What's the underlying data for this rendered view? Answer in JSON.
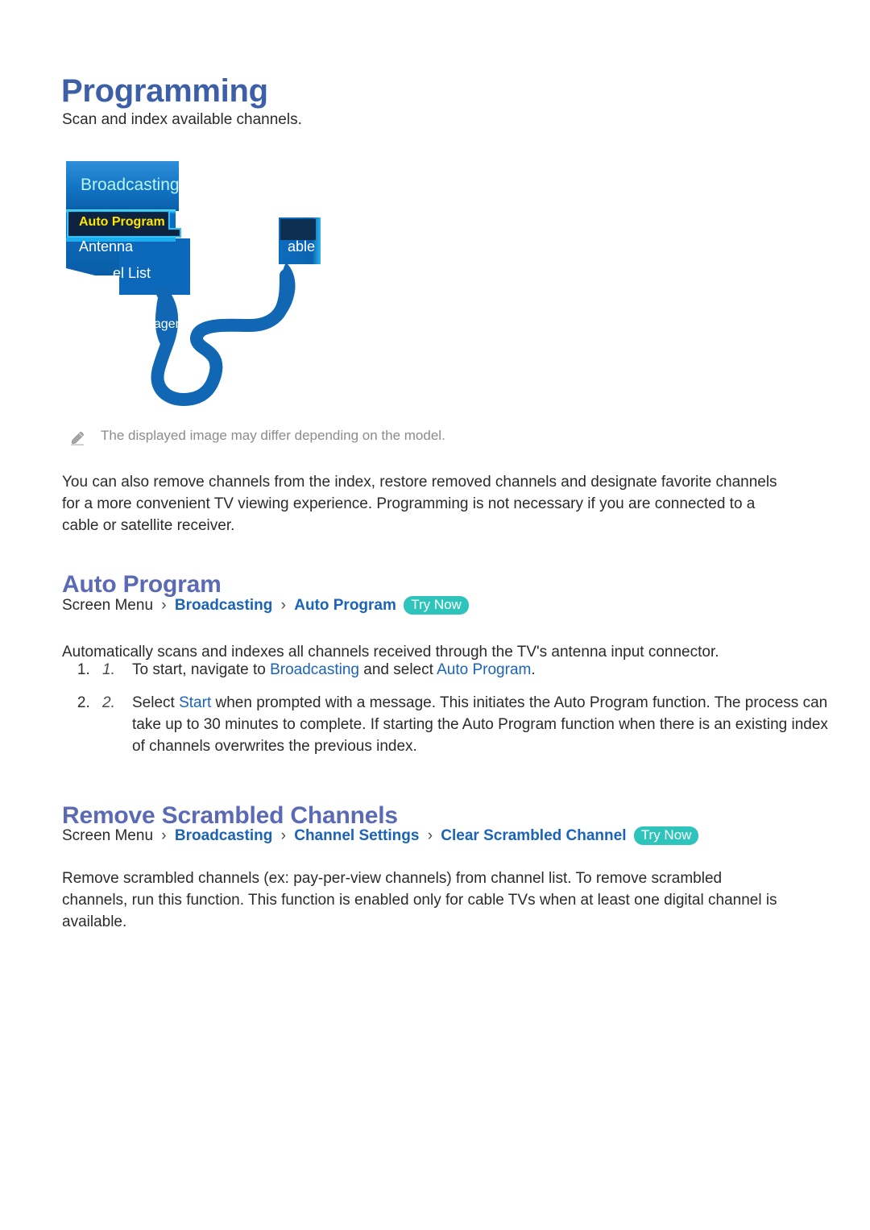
{
  "document": {
    "title": "Programming",
    "intro": "Scan and index available channels."
  },
  "illustration": {
    "menu_title": "Broadcasting",
    "items": [
      {
        "label": "Auto Program",
        "state": "highlighted"
      },
      {
        "label": "Antenna",
        "state": "normal"
      },
      {
        "label": "el List",
        "state": "clipped"
      },
      {
        "label": "nager",
        "state": "clipped"
      },
      {
        "label": "able",
        "state": "clipped"
      }
    ],
    "colors": {
      "panel_blue": "#0b6cc0",
      "panel_blue_dark": "#0a5fa8",
      "header_gradient_top": "#2f8fd8",
      "header_gradient_bottom": "#0a63b4",
      "highlight_fill": "#0d2340",
      "highlight_glow": "#27c6ff",
      "highlight_text": "#ffe500",
      "title_text": "#b8f5ef",
      "cable_blue": "#1167b4"
    }
  },
  "note": {
    "icon": "pencil-icon",
    "text": "The displayed image may differ depending on the model."
  },
  "paragraphs": {
    "remove_channels": "You can also remove channels from the index, restore removed channels and designate favorite channels for a more convenient TV viewing experience. Programming is not necessary if you are connected to a cable or satellite receiver.",
    "auto_scan": "Automatically scans and indexes all channels received through the TV's antenna input connector.",
    "remove_scrambled": "Remove scrambled channels (ex: pay-per-view channels) from channel list. To remove scrambled channels, run this function. This function is enabled only for cable TVs when at least one digital channel is available."
  },
  "sections": [
    {
      "id": "auto-program",
      "heading": "Auto Program",
      "breadcrumb": {
        "root": "Screen Menu",
        "separator": "›",
        "links": [
          "Broadcasting",
          "Auto Program"
        ],
        "badge": "Try Now"
      }
    },
    {
      "id": "remove-scrambled",
      "heading": "Remove Scrambled Channels",
      "breadcrumb": {
        "root": "Screen Menu",
        "separator": "›",
        "links": [
          "Broadcasting",
          "Channel Settings",
          "Clear Scrambled Channel"
        ],
        "badge": "Try Now"
      }
    }
  ],
  "steps": [
    {
      "number": "1.",
      "parts": [
        {
          "text": "To start, navigate to ",
          "kind": "plain"
        },
        {
          "text": "Broadcasting",
          "kind": "keyword"
        },
        {
          "text": " and select ",
          "kind": "plain"
        },
        {
          "text": "Auto Program",
          "kind": "keyword"
        },
        {
          "text": ".",
          "kind": "plain"
        }
      ]
    },
    {
      "number": "2.",
      "parts": [
        {
          "text": "Select ",
          "kind": "plain"
        },
        {
          "text": "Start",
          "kind": "keyword"
        },
        {
          "text": " when prompted with a message. This initiates the Auto Program function. The process can take up to 30 minutes to complete. If starting the Auto Program function when there is an existing index of channels overwrites the previous index.",
          "kind": "plain"
        }
      ]
    }
  ],
  "theme": {
    "title_color": "#3c5fa8",
    "section_heading_color": "#5b6ab5",
    "link_color": "#1a63b8",
    "badge_color": "#2ec4bb",
    "body_color": "#2b2b2b",
    "note_color": "#8c8c8c"
  }
}
